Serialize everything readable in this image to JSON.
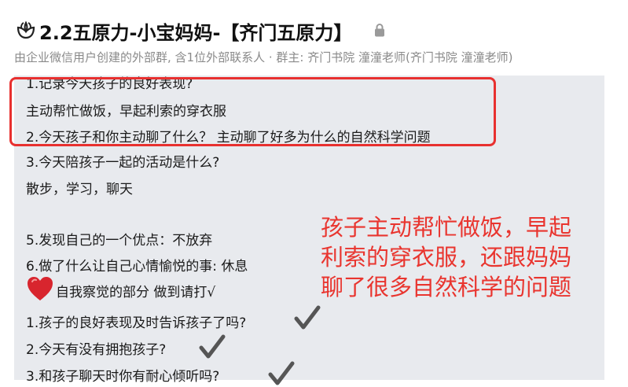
{
  "header": {
    "title": "2.2五原力-小宝妈妈-【齐门五原力】",
    "subtitle": "由企业微信用户创建的外部群, 含1位外部联系人 · 群主: 齐门书院 潼潼老师(齐门书院 潼潼老师)"
  },
  "message": {
    "lines": [
      " 1.记录今天孩子的良好表现?",
      "主动帮忙做饭，早起利索的穿衣服",
      " 2.今天孩子和你主动聊了什么？ 主动聊了好多为什么的自然科学问题",
      " 3.今天陪孩子一起的活动是什么?",
      "散步，学习，聊天",
      " 5.发现自己的一个优点：不放弃",
      "  6.做了什么让自己心情愉悦的事:   休息",
      "自我察觉的部分 做到请打√",
      " 1.孩子的良好表现及时告诉孩子了吗?",
      " 2.今天有没有拥抱孩子?",
      "  3.和孩子聊天时你有耐心倾听吗?"
    ],
    "annotation": "孩子主动帮忙做饭，早起\n利索的穿衣服，还跟妈妈\n聊了很多自然科学的问题"
  },
  "colors": {
    "highlight": "#e8302f",
    "annotation": "#e9352f",
    "panel_bg": "#e8eaee",
    "heart": "#d8252e",
    "check": "#555555"
  },
  "icons": [
    "flower-group-icon",
    "lock-icon",
    "heart-icon",
    "check-mark-icon"
  ]
}
